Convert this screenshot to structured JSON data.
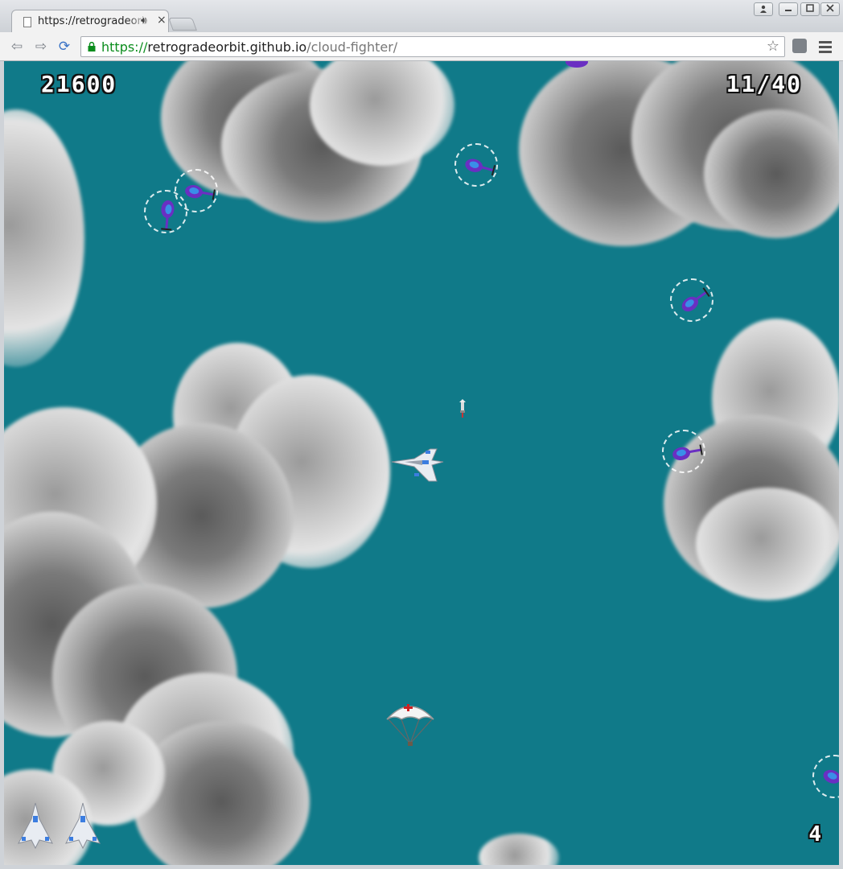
{
  "browser": {
    "tab_title": "https://retrogradeorbit.github.io/cloud-fighter/",
    "tab_audio_icon": "speaker-icon",
    "tab_close_glyph": "×",
    "url_scheme": "https://",
    "url_host": "retrogradeorbit.github.io",
    "url_path": "/cloud-fighter/",
    "window_buttons": [
      "user-icon",
      "minimize-icon",
      "maximize-icon",
      "close-icon"
    ]
  },
  "game": {
    "background_color": "#107a89",
    "score": "21600",
    "kills_counter": "11/40",
    "bombs_count": "4",
    "lives_remaining": 2,
    "enemies": "purple helicopters with dashed target rings",
    "player": "white jet fighter",
    "pickup": "parachute supply drop with red cross"
  }
}
